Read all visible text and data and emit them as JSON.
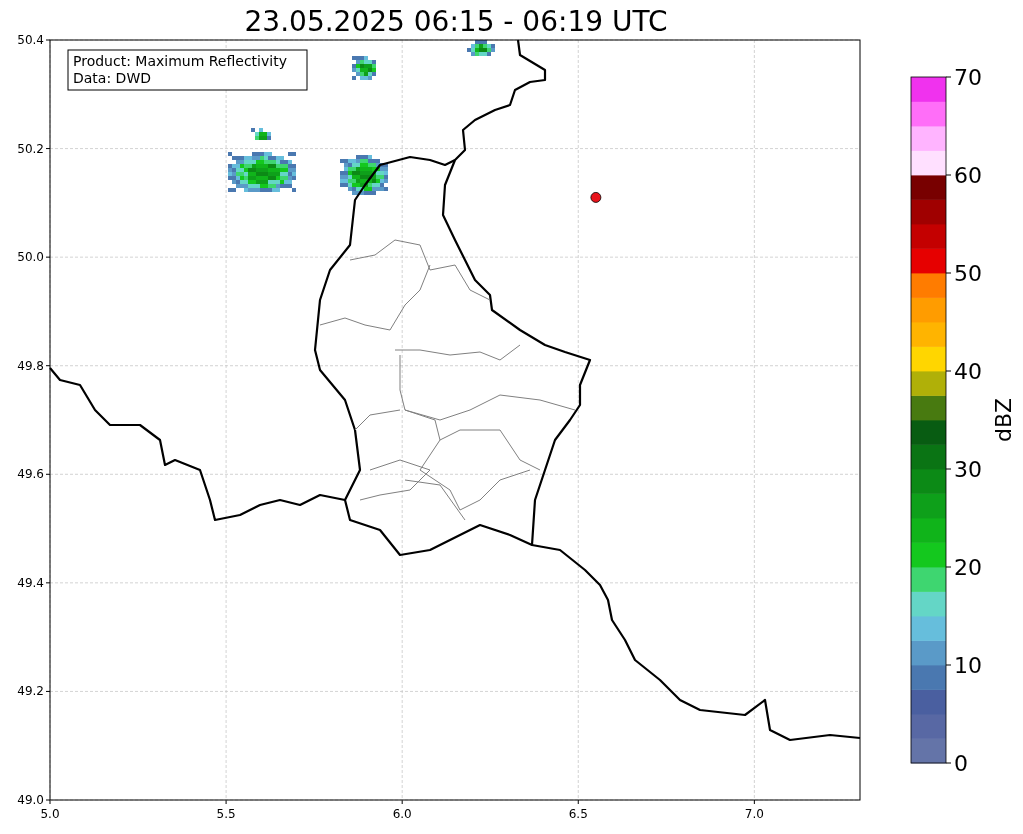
{
  "figure": {
    "title": "23.05.2025 06:15 - 06:19 UTC",
    "info_box": [
      "Product: Maximum Reflectivity",
      "Data: DWD"
    ],
    "map": {
      "chart_data": {
        "type": "scatter",
        "grid": true,
        "xlim": [
          5.0,
          7.3
        ],
        "ylim": [
          49.0,
          50.4
        ],
        "xticks": [
          {
            "value": 5.0,
            "label": "5.0"
          },
          {
            "value": 5.5,
            "label": "5.5"
          },
          {
            "value": 6.0,
            "label": "6.0"
          },
          {
            "value": 6.5,
            "label": "6.5"
          },
          {
            "value": 7.0,
            "label": "7.0"
          }
        ],
        "yticks": [
          {
            "value": 49.0,
            "label": "49.0"
          },
          {
            "value": 49.2,
            "label": "49.2"
          },
          {
            "value": 49.4,
            "label": "49.4"
          },
          {
            "value": 49.6,
            "label": "49.6"
          },
          {
            "value": 49.8,
            "label": "49.8"
          },
          {
            "value": 50.0,
            "label": "50.0"
          },
          {
            "value": 50.2,
            "label": "50.2"
          },
          {
            "value": 50.4,
            "label": "50.4"
          }
        ],
        "x": [
          6.55
        ],
        "series": [
          {
            "color": "#e8141c",
            "values": [
              50.11
            ]
          }
        ]
      }
    },
    "colorbar": {
      "label": "dBZ",
      "ticks": [
        "70",
        "60",
        "50",
        "40",
        "30",
        "20",
        "10",
        "0"
      ],
      "bands": [
        {
          "color": "#6474a8"
        },
        {
          "color": "#5868a4"
        },
        {
          "color": "#4a5fa0"
        },
        {
          "color": "#4a78b0"
        },
        {
          "color": "#5a9ac8"
        },
        {
          "color": "#66bedc"
        },
        {
          "color": "#64d6c6"
        },
        {
          "color": "#3ed670"
        },
        {
          "color": "#14c81e"
        },
        {
          "color": "#10b41a"
        },
        {
          "color": "#0ea01a"
        },
        {
          "color": "#0c8a16"
        },
        {
          "color": "#0a7414"
        },
        {
          "color": "#085c12"
        },
        {
          "color": "#487a10"
        },
        {
          "color": "#b0b008"
        },
        {
          "color": "#ffd600"
        },
        {
          "color": "#ffb400"
        },
        {
          "color": "#ff9c00"
        },
        {
          "color": "#ff7c00"
        },
        {
          "color": "#e60000"
        },
        {
          "color": "#c40000"
        },
        {
          "color": "#a00000"
        },
        {
          "color": "#780000"
        },
        {
          "color": "#ffe0ff"
        },
        {
          "color": "#ffb4ff"
        },
        {
          "color": "#ff6ef8"
        },
        {
          "color": "#f032ee"
        }
      ]
    }
  }
}
